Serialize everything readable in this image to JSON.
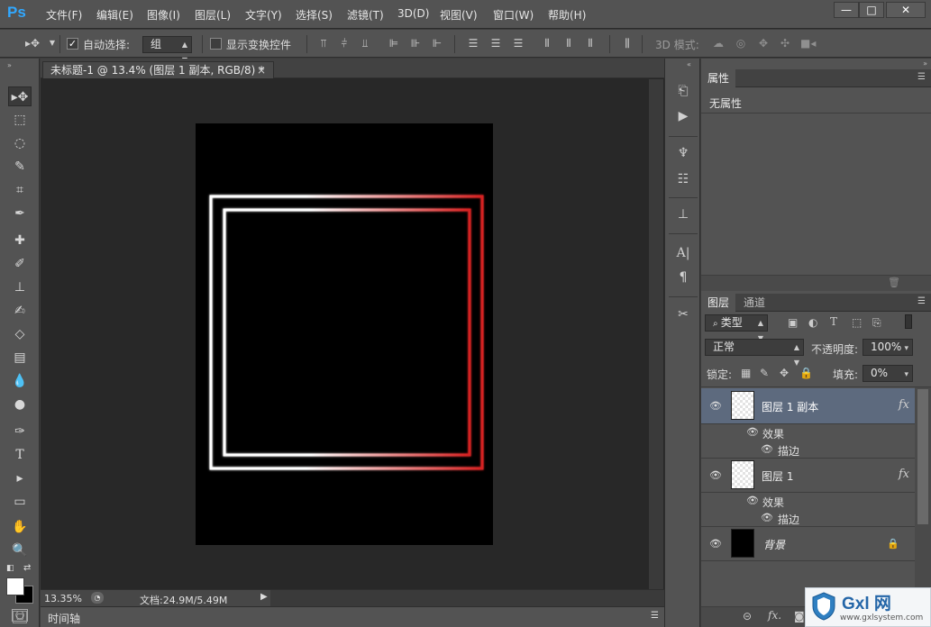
{
  "app": {
    "logo": "Ps",
    "menu": [
      "文件(F)",
      "编辑(E)",
      "图像(I)",
      "图层(L)",
      "文字(Y)",
      "选择(S)",
      "滤镜(T)",
      "3D(D)",
      "视图(V)",
      "窗口(W)",
      "帮助(H)"
    ],
    "window_controls": {
      "minimize": "—",
      "maximize": "□",
      "close": "✕"
    }
  },
  "options": {
    "auto_select_label": "自动选择:",
    "auto_select_checked": true,
    "auto_select_value": "组",
    "show_transform_label": "显示变换控件",
    "show_transform_checked": false,
    "mode_3d_label": "3D 模式:"
  },
  "document": {
    "tab_title": "未标题-1 @ 13.4% (图层 1 副本, RGB/8) *",
    "tab_close": "×",
    "zoom": "13.35%",
    "doc_size": "文档:24.9M/5.49M",
    "timeline_label": "时间轴"
  },
  "properties": {
    "tab": "属性",
    "empty_text": "无属性"
  },
  "layers": {
    "tabs": [
      "图层",
      "通道"
    ],
    "filter_kind": "类型",
    "blend_mode": "正常",
    "opacity_label": "不透明度:",
    "opacity_value": "100%",
    "lock_label": "锁定:",
    "fill_label": "填充:",
    "fill_value": "0%",
    "items": [
      {
        "name": "图层 1 副本",
        "fx": "fx",
        "effects_label": "效果",
        "effect": "描边",
        "selected": true
      },
      {
        "name": "图层 1",
        "fx": "fx",
        "effects_label": "效果",
        "effect": "描边",
        "selected": false
      },
      {
        "name": "背景",
        "locked": true
      }
    ]
  },
  "colors": {
    "canvas": "#000000",
    "frame_gradient_start": "#ffffff",
    "frame_gradient_end": "#d42020",
    "accent_selected": "#5d6a7e"
  },
  "watermark": {
    "brand": "Gxl 网",
    "url": "www.gxlsystem.com"
  }
}
